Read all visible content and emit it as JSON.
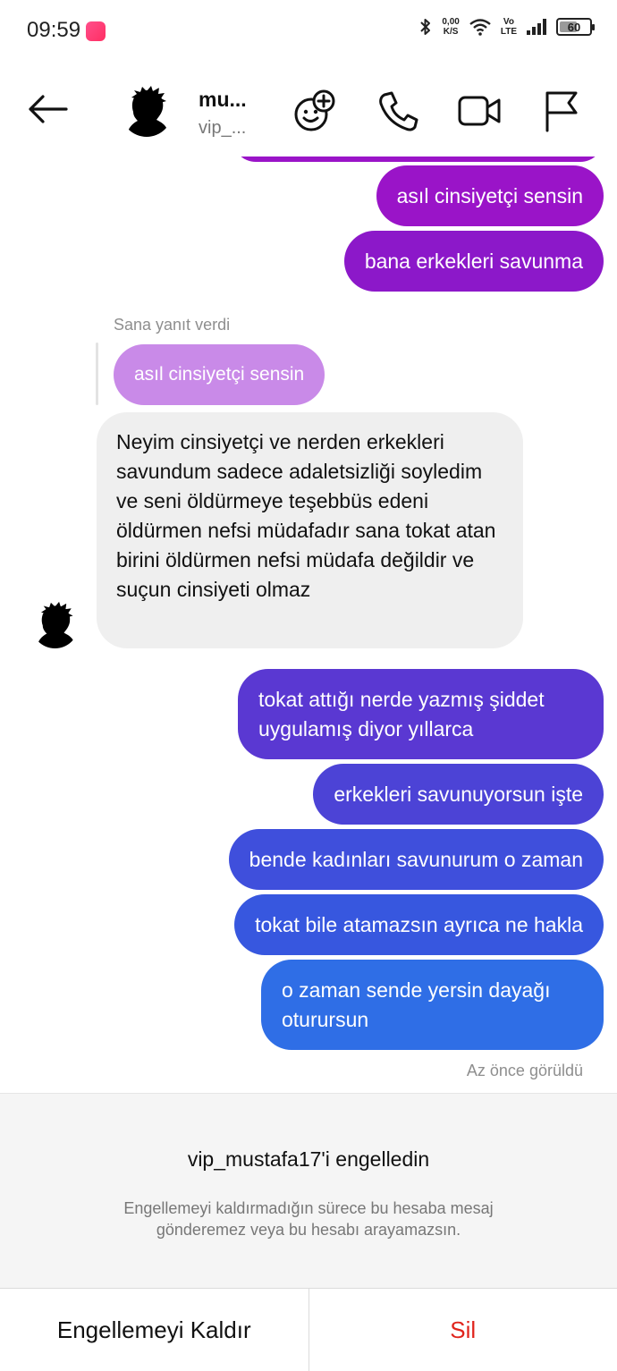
{
  "status_bar": {
    "time": "09:59",
    "net_speed_value": "0,00",
    "net_speed_unit": "K/S",
    "volte_top": "Vo",
    "volte_bottom": "LTE",
    "battery": "60",
    "battery_level_percent": 60
  },
  "header": {
    "name": "mu...",
    "username": "vip_...",
    "icons": [
      "back-arrow-icon",
      "effects-icon",
      "phone-icon",
      "video-camera-icon",
      "flag-icon"
    ]
  },
  "messages": {
    "out_1": "asıl cinsiyetçi sensin",
    "out_2": "bana erkekleri savunma",
    "reply_label": "Sana yanıt verdi",
    "reply_quote": "asıl cinsiyetçi sensin",
    "incoming": "Neyim cinsiyetçi ve nerden erkekleri savundum sadece adaletsizliği soyledim ve seni öldürmeye teşebbüs edeni öldürmen nefsi müdafadır sana tokat atan birini öldürmen nefsi müdafa değildir ve suçun cinsiyeti olmaz",
    "out_3": "tokat attığı nerde yazmış şiddet uygulamış diyor yıllarca",
    "out_4": "erkekleri savunuyorsun işte",
    "out_5": "bende kadınları savunurum o zaman",
    "out_6": "tokat bile atamazsın ayrıca ne hakla",
    "out_7": "o zaman sende yersin dayağı oturursun",
    "seen": "Az önce görüldü"
  },
  "block": {
    "title": "vip_mustafa17'i engelledin",
    "description": "Engellemeyi kaldırmadığın sürece bu hesaba mesaj gönderemez veya bu hesabı arayamazsın.",
    "unblock_label": "Engellemeyi Kaldır",
    "delete_label": "Sil"
  },
  "colors": {
    "out_purple": "#9a14c8",
    "out_violet": "#6a2fd0",
    "out_blue": "#2f6ee6",
    "incoming_bg": "#efefef",
    "delete_red": "#e0241c"
  }
}
